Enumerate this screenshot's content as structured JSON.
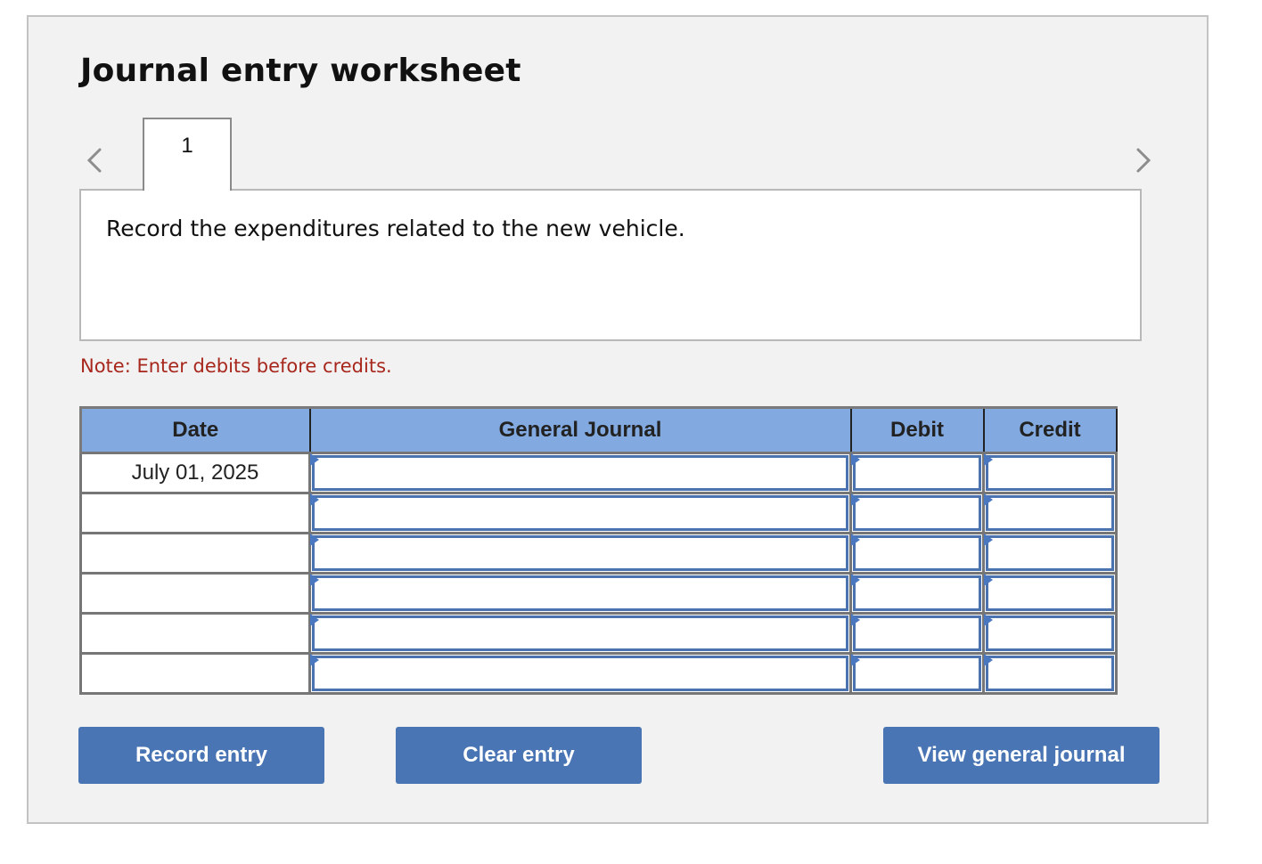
{
  "worksheet": {
    "title": "Journal entry worksheet",
    "tabs": [
      {
        "label": "1",
        "active": true
      }
    ],
    "question": "Record the expenditures related to the new vehicle.",
    "note": "Note: Enter debits before credits."
  },
  "table": {
    "columns": [
      "Date",
      "General Journal",
      "Debit",
      "Credit"
    ],
    "rows": [
      {
        "date": "July 01, 2025",
        "account": "",
        "debit": "",
        "credit": ""
      },
      {
        "date": "",
        "account": "",
        "debit": "",
        "credit": ""
      },
      {
        "date": "",
        "account": "",
        "debit": "",
        "credit": ""
      },
      {
        "date": "",
        "account": "",
        "debit": "",
        "credit": ""
      },
      {
        "date": "",
        "account": "",
        "debit": "",
        "credit": ""
      },
      {
        "date": "",
        "account": "",
        "debit": "",
        "credit": ""
      }
    ]
  },
  "buttons": {
    "record": "Record entry",
    "clear": "Clear entry",
    "view": "View general journal"
  },
  "colors": {
    "header_bg": "#82aae0",
    "button_bg": "#4a75b4",
    "note_text": "#a8271c",
    "input_border": "#4a73b0"
  }
}
